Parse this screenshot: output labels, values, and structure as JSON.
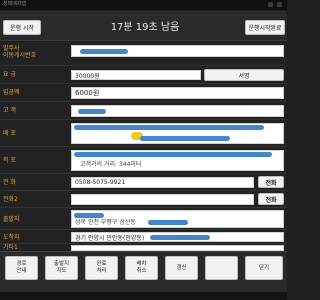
{
  "topbar": {
    "title": "청매배차앱"
  },
  "header": {
    "start_label": "운행 시작",
    "timer_text": "17분 19초 남음",
    "confirm_label": "운행시작완료"
  },
  "form": {
    "dispatch_label": "발주사\n이동개시번호",
    "fare_label": "요 금",
    "fare_value": "30000원",
    "fare_button": "서명",
    "deposit_label": "입금액",
    "deposit_value": "6000원",
    "customer_label": "고 객",
    "pickup_label": "배 포",
    "dropoff_label": "적 포",
    "dropoff_value": "고객과의 거리: 344미터",
    "phone_label": "전 화",
    "phone_value": "0508-5075-9921",
    "phone_button": "전화",
    "phone2_label": "전화2",
    "phone2_button": "전화",
    "departure_label": "출발지",
    "departure_value": "성북 인천 부평구 삼산동",
    "arrival_label": "도착지",
    "arrival_value": "경기 안양시 만안동(안양동)",
    "extra_label": "기타1"
  },
  "bottom": [
    {
      "line1": "경로",
      "line2": "안내"
    },
    {
      "line1": "출발지",
      "line2": "지도"
    },
    {
      "line1": "완료",
      "line2": "처리"
    },
    {
      "line1": "배차",
      "line2": "취소"
    },
    {
      "line1": "갱신",
      "line2": ""
    },
    {
      "line1": "",
      "line2": ""
    },
    {
      "line1": "닫기",
      "line2": ""
    }
  ],
  "colors": {
    "label": "#e0a43a",
    "background": "#222222",
    "field": "#ffffff",
    "redaction": "#3f86d6"
  }
}
